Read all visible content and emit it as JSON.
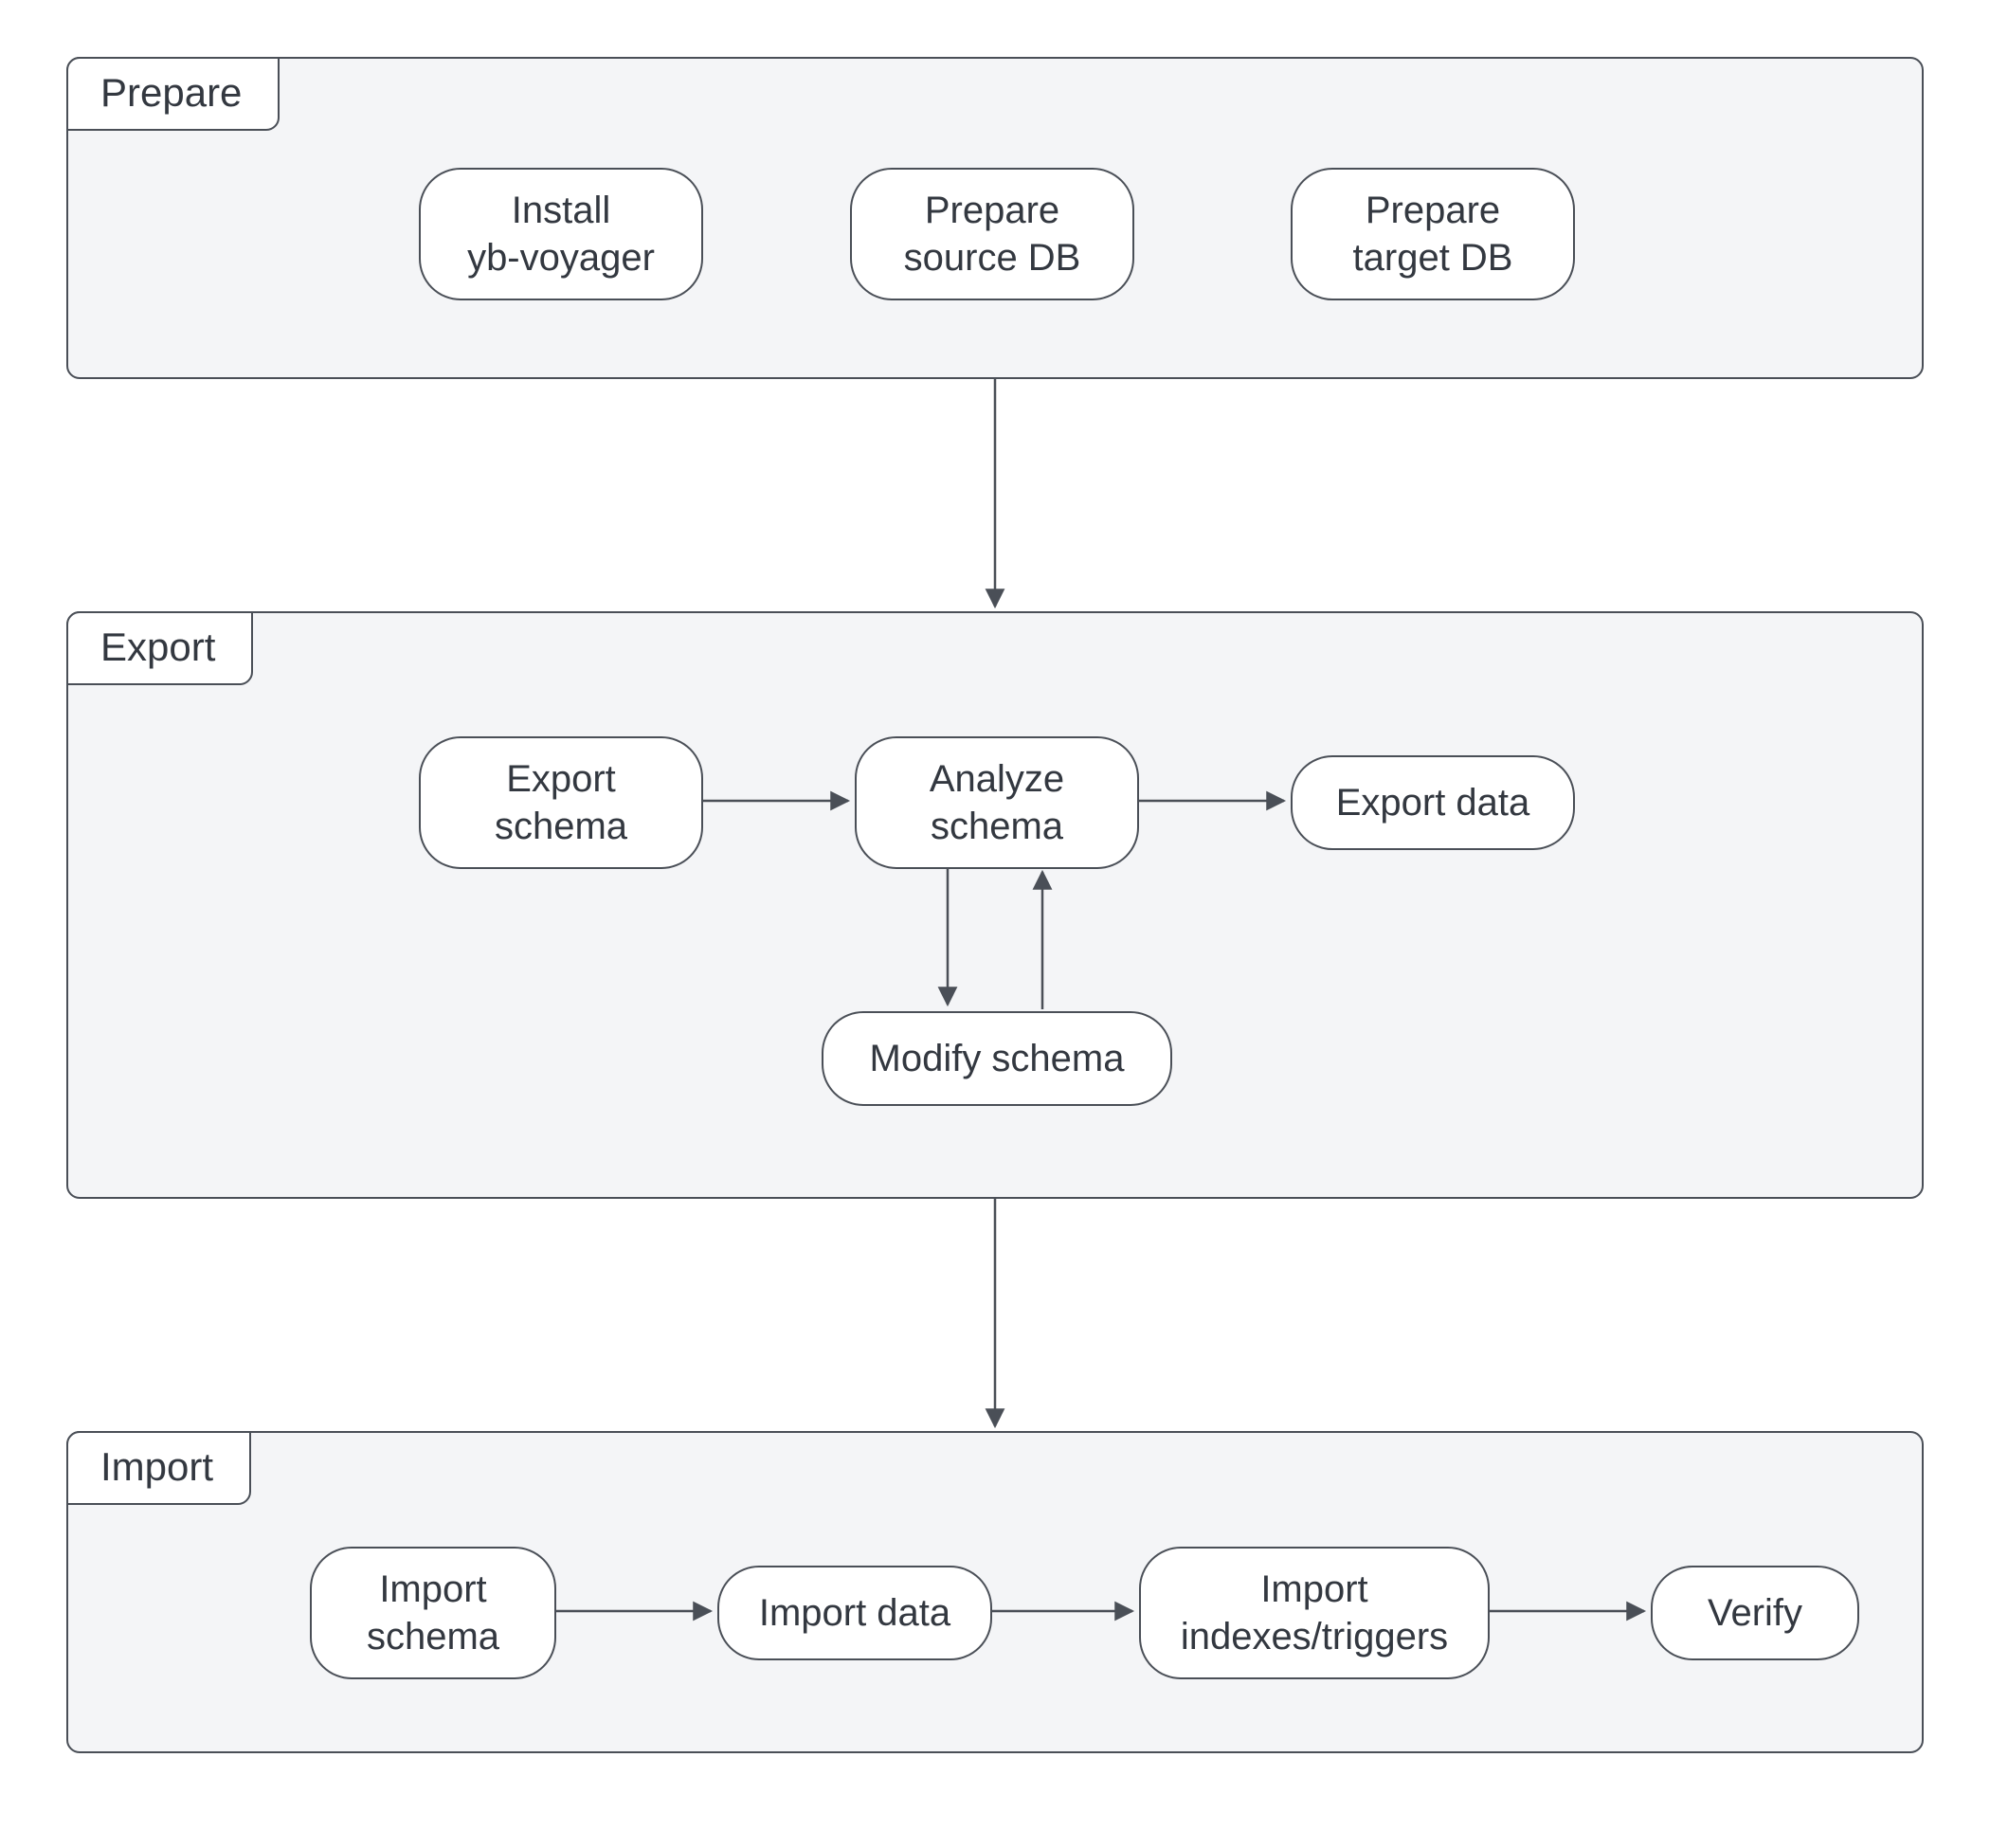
{
  "phases": {
    "prepare": {
      "label": "Prepare"
    },
    "export": {
      "label": "Export"
    },
    "import": {
      "label": "Import"
    }
  },
  "nodes": {
    "install_yb_voyager": "Install\nyb-voyager",
    "prepare_source_db": "Prepare\nsource DB",
    "prepare_target_db": "Prepare\ntarget DB",
    "export_schema": "Export\nschema",
    "analyze_schema": "Analyze\nschema",
    "export_data": "Export data",
    "modify_schema": "Modify schema",
    "import_schema": "Import\nschema",
    "import_data": "Import data",
    "import_indexes_triggers": "Import\nindexes/triggers",
    "verify": "Verify"
  },
  "chart_data": {
    "type": "flowchart",
    "phases": [
      "Prepare",
      "Export",
      "Import"
    ],
    "nodes": [
      {
        "id": "install_yb_voyager",
        "label": "Install yb-voyager",
        "phase": "Prepare"
      },
      {
        "id": "prepare_source_db",
        "label": "Prepare source DB",
        "phase": "Prepare"
      },
      {
        "id": "prepare_target_db",
        "label": "Prepare target DB",
        "phase": "Prepare"
      },
      {
        "id": "export_schema",
        "label": "Export schema",
        "phase": "Export"
      },
      {
        "id": "analyze_schema",
        "label": "Analyze schema",
        "phase": "Export"
      },
      {
        "id": "export_data",
        "label": "Export data",
        "phase": "Export"
      },
      {
        "id": "modify_schema",
        "label": "Modify schema",
        "phase": "Export"
      },
      {
        "id": "import_schema",
        "label": "Import schema",
        "phase": "Import"
      },
      {
        "id": "import_data",
        "label": "Import data",
        "phase": "Import"
      },
      {
        "id": "import_indexes_triggers",
        "label": "Import indexes/triggers",
        "phase": "Import"
      },
      {
        "id": "verify",
        "label": "Verify",
        "phase": "Import"
      }
    ],
    "edges": [
      {
        "from": "phase:Prepare",
        "to": "phase:Export"
      },
      {
        "from": "phase:Export",
        "to": "phase:Import"
      },
      {
        "from": "export_schema",
        "to": "analyze_schema"
      },
      {
        "from": "analyze_schema",
        "to": "export_data"
      },
      {
        "from": "analyze_schema",
        "to": "modify_schema"
      },
      {
        "from": "modify_schema",
        "to": "analyze_schema"
      },
      {
        "from": "import_schema",
        "to": "import_data"
      },
      {
        "from": "import_data",
        "to": "import_indexes_triggers"
      },
      {
        "from": "import_indexes_triggers",
        "to": "verify"
      }
    ]
  },
  "colors": {
    "phase_bg": "#f4f5f7",
    "stroke": "#4a4f57",
    "node_bg": "#ffffff",
    "text": "#333840"
  }
}
